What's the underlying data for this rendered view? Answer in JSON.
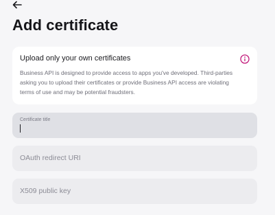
{
  "header": {
    "title": "Add certificate",
    "back_icon": "arrow-left-icon"
  },
  "notice": {
    "title": "Upload only your own certificates",
    "body": "Business API is designed to provide access to apps you've developed. Third-parties asking you to upload their certificates or provide Business API access are violating terms of use and may be potential fraudsters.",
    "icon": "info-icon",
    "icon_color": "#c2187a"
  },
  "form": {
    "certificate_title": {
      "label": "Certificate title",
      "value": ""
    },
    "oauth_redirect_uri": {
      "placeholder": "OAuth redirect URI"
    },
    "x509_public_key": {
      "placeholder": "X509 public key"
    }
  }
}
